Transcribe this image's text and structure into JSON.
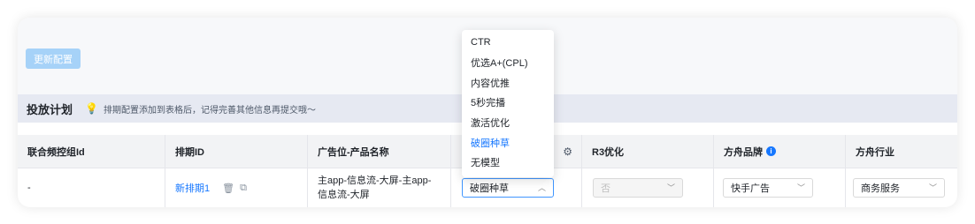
{
  "toolbar": {
    "update_label": "更新配置"
  },
  "section": {
    "title": "投放计划",
    "tip": "排期配置添加到表格后，记得完善其他信息再提交哦～"
  },
  "table": {
    "headers": [
      "联合频控组Id",
      "排期ID",
      "广告位-产品名称",
      "",
      "R3优化",
      "方舟品牌",
      "方舟行业"
    ],
    "row": {
      "joint_id": "-",
      "schedule_id": "新排期1",
      "placement_line1": "主app-信息流-大屏-主app-",
      "placement_line2": "信息流-大屏",
      "goal_value": "破圈种草",
      "r3_value": "否",
      "brand_value": "快手广告",
      "industry_value": "商务服务"
    }
  },
  "dropdown": {
    "options": [
      "CTR",
      "优选A+(CPL)",
      "内容优推",
      "5秒完播",
      "激活优化",
      "破圈种草",
      "无模型"
    ],
    "selected": "破圈种草"
  },
  "icons": {
    "tip": "lightbulb-icon",
    "delete": "trash-icon",
    "copy": "copy-icon",
    "settings": "gear-icon",
    "info": "info-icon",
    "chevron": "chevron-down-icon"
  }
}
